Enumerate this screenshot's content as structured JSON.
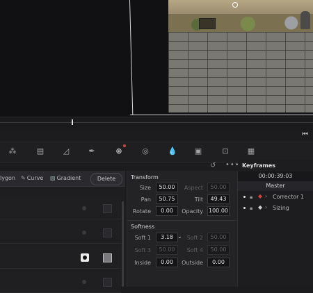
{
  "shape_bar": {
    "polygon_label": "lygon",
    "curve_label": "Curve",
    "gradient_label": "Gradient",
    "delete_label": "Delete"
  },
  "transform": {
    "title": "Transform",
    "fields": {
      "size": {
        "label": "Size",
        "value": "50.00"
      },
      "aspect": {
        "label": "Aspect",
        "value": "50.00"
      },
      "pan": {
        "label": "Pan",
        "value": "50.75"
      },
      "tilt": {
        "label": "Tilt",
        "value": "49.43"
      },
      "rotate": {
        "label": "Rotate",
        "value": "0.00"
      },
      "opacity": {
        "label": "Opacity",
        "value": "100.00"
      }
    }
  },
  "softness": {
    "title": "Softness",
    "fields": {
      "soft1": {
        "label": "Soft 1",
        "value": "3.18"
      },
      "soft2": {
        "label": "Soft 2",
        "value": "50.00"
      },
      "soft3": {
        "label": "Soft 3",
        "value": "50.00"
      },
      "soft4": {
        "label": "Soft 4",
        "value": "50.00"
      },
      "inside": {
        "label": "Inside",
        "value": "0.00"
      },
      "outside": {
        "label": "Outside",
        "value": "0.00"
      }
    }
  },
  "keyframes": {
    "title": "Keyframes",
    "timecode": "00:00:39:03",
    "master_label": "Master",
    "rows": [
      {
        "name": "Corrector 1",
        "diamond_color": "#d0453b"
      },
      {
        "name": "Sizing",
        "diamond_color": "#cfcfcf"
      }
    ]
  },
  "icons": {
    "skip_back": "skip-back-icon",
    "reset": "reset-icon",
    "more": "more-options-icon"
  }
}
